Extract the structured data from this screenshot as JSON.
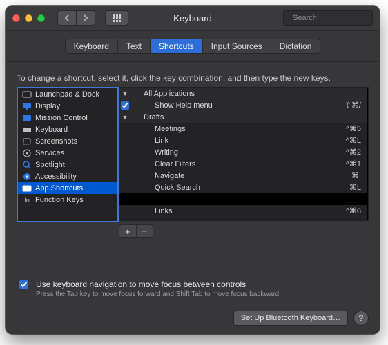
{
  "window": {
    "title": "Keyboard"
  },
  "search": {
    "placeholder": "Search"
  },
  "tabs": {
    "items": [
      "Keyboard",
      "Text",
      "Shortcuts",
      "Input Sources",
      "Dictation"
    ],
    "active_index": 2
  },
  "hint": "To change a shortcut, select it, click the key combination, and then type the new keys.",
  "categories": {
    "items": [
      {
        "label": "Launchpad & Dock"
      },
      {
        "label": "Display"
      },
      {
        "label": "Mission Control"
      },
      {
        "label": "Keyboard"
      },
      {
        "label": "Screenshots"
      },
      {
        "label": "Services"
      },
      {
        "label": "Spotlight"
      },
      {
        "label": "Accessibility"
      },
      {
        "label": "App Shortcuts"
      },
      {
        "label": "Function Keys"
      }
    ],
    "selected_index": 8
  },
  "shortcuts": {
    "sections": [
      {
        "name": "All Applications",
        "expanded": true,
        "items": [
          {
            "label": "Show Help menu",
            "keys": "⇧⌘/",
            "checked": true,
            "selected": true
          }
        ]
      },
      {
        "name": "Drafts",
        "expanded": true,
        "items": [
          {
            "label": "Meetings",
            "keys": "^⌘5"
          },
          {
            "label": "Link",
            "keys": "^⌘L"
          },
          {
            "label": "Writing",
            "keys": "^⌘2"
          },
          {
            "label": "Clear Filters",
            "keys": "^⌘1"
          },
          {
            "label": "Navigate",
            "keys": "⌘;"
          },
          {
            "label": "Quick Search",
            "keys": "⌘L"
          },
          {
            "label": "",
            "keys": "",
            "black": true
          },
          {
            "label": "Links",
            "keys": "^⌘6"
          }
        ]
      }
    ]
  },
  "footer": {
    "checkbox_label": "Use keyboard navigation to move focus between controls",
    "checkbox_checked": true,
    "sub": "Press the Tab key to move focus forward and Shift Tab to move focus backward."
  },
  "buttons": {
    "bluetooth": "Set Up Bluetooth Keyboard…",
    "help": "?"
  },
  "glyphs": {
    "fnkey": "fn"
  }
}
